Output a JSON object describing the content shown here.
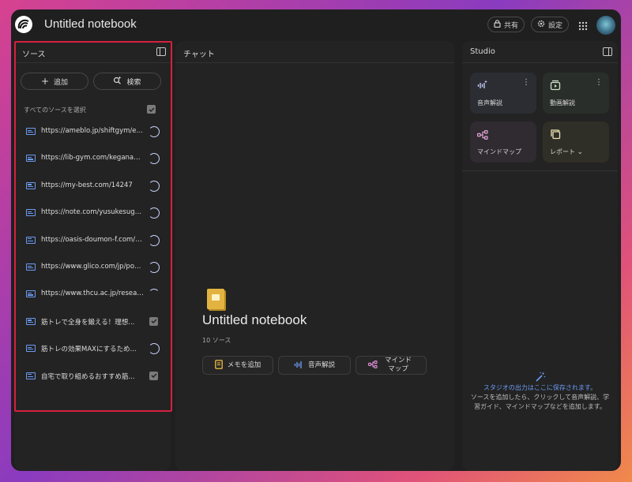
{
  "app": {
    "title": "Untitled notebook",
    "share_label": "共有",
    "settings_label": "設定"
  },
  "sources": {
    "title": "ソース",
    "add_label": "追加",
    "search_label": "検索",
    "select_all_label": "すべてのソースを選択",
    "items": [
      {
        "label": "https://ameblo.jp/shiftgym/entr...",
        "status": "loading"
      },
      {
        "label": "https://lib-gym.com/keganaku...",
        "status": "loading"
      },
      {
        "label": "https://my-best.com/14247",
        "status": "loading"
      },
      {
        "label": "https://note.com/yusukesugaw...",
        "status": "loading"
      },
      {
        "label": "https://oasis-doumon-f.com/2...",
        "status": "loading"
      },
      {
        "label": "https://www.glico.com/jp/powe...",
        "status": "loading"
      },
      {
        "label": "https://www.thcu.ac.jp/researc...",
        "status": "loading-partial"
      },
      {
        "label": "筋トレで全身を鍛える！理想...",
        "status": "checked"
      },
      {
        "label": "筋トレの効果MAXにするため...",
        "status": "loading"
      },
      {
        "label": "自宅で取り組めるおすすめ筋...",
        "status": "checked"
      }
    ]
  },
  "chat": {
    "title": "チャット",
    "notebook_title": "Untitled notebook",
    "source_count": "10 ソース",
    "actions": [
      {
        "label": "メモを追加",
        "icon": "note-icon"
      },
      {
        "label": "音声解説",
        "icon": "audio-icon"
      },
      {
        "label": "マインドマップ",
        "icon": "mindmap-icon"
      }
    ]
  },
  "studio": {
    "title": "Studio",
    "cards": [
      {
        "label": "音声解説",
        "icon": "audio-wave-icon"
      },
      {
        "label": "動画解説",
        "icon": "video-icon"
      },
      {
        "label": "マインドマップ",
        "icon": "mindmap-icon"
      },
      {
        "label": "レポート",
        "icon": "report-icon"
      }
    ],
    "empty_title": "スタジオの出力はここに保存されます。",
    "empty_desc": "ソースを追加したら、クリックして音声解説、学習ガイド、マインドマップなどを追加します。"
  },
  "colors": {
    "accent_blue": "#6b9bf2",
    "highlight_red": "#d4213d",
    "card_audio": "#2b2d33",
    "card_video": "#2a2e2a",
    "card_mindmap": "#302a31",
    "card_report": "#302f27"
  }
}
